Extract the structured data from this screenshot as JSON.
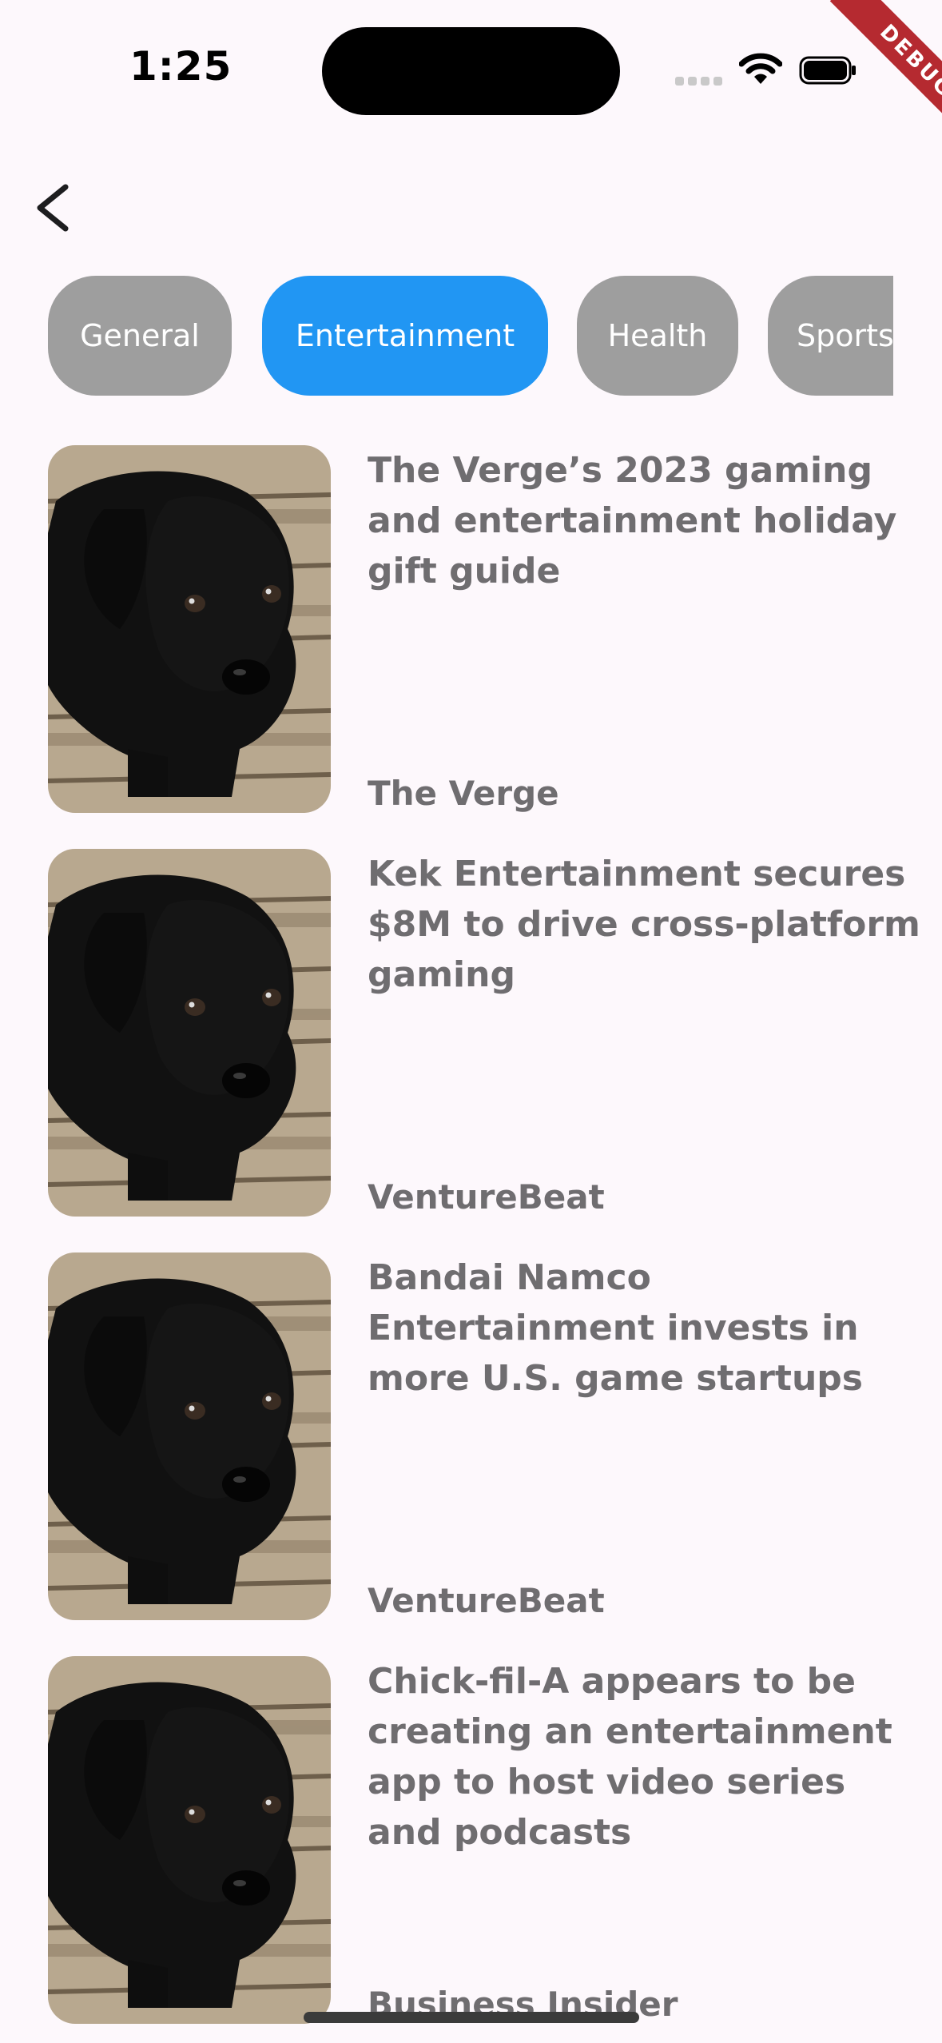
{
  "status_bar": {
    "time": "1:25",
    "debug_label": "DEBUG",
    "icons": [
      "cellular-signal-icon",
      "wifi-icon",
      "battery-icon"
    ]
  },
  "nav": {
    "back_icon": "chevron-left-icon"
  },
  "colors": {
    "background": "#fdf8fc",
    "tab_inactive": "#9e9e9e",
    "tab_active": "#2196f3",
    "text": "#6f6d70",
    "debug": "#b52a30"
  },
  "tabs": [
    {
      "label": "General",
      "active": false
    },
    {
      "label": "Entertainment",
      "active": true
    },
    {
      "label": "Health",
      "active": false
    },
    {
      "label": "Sports",
      "active": false
    }
  ],
  "articles": [
    {
      "title": "The Verge’s 2023 gaming and entertainment holiday gift guide",
      "source": "The Verge",
      "image": "black-puppy-photo"
    },
    {
      "title": "Kek Entertainment secures $8M to drive cross-platform gaming",
      "source": "VentureBeat",
      "image": "black-puppy-photo"
    },
    {
      "title": "Bandai Namco Entertainment invests in more U.S. game startups",
      "source": "VentureBeat",
      "image": "black-puppy-photo"
    },
    {
      "title": "Chick-fil-A appears to be creating an entertainment app to host video series and podcasts",
      "source": "Business Insider",
      "image": "black-puppy-photo"
    }
  ]
}
